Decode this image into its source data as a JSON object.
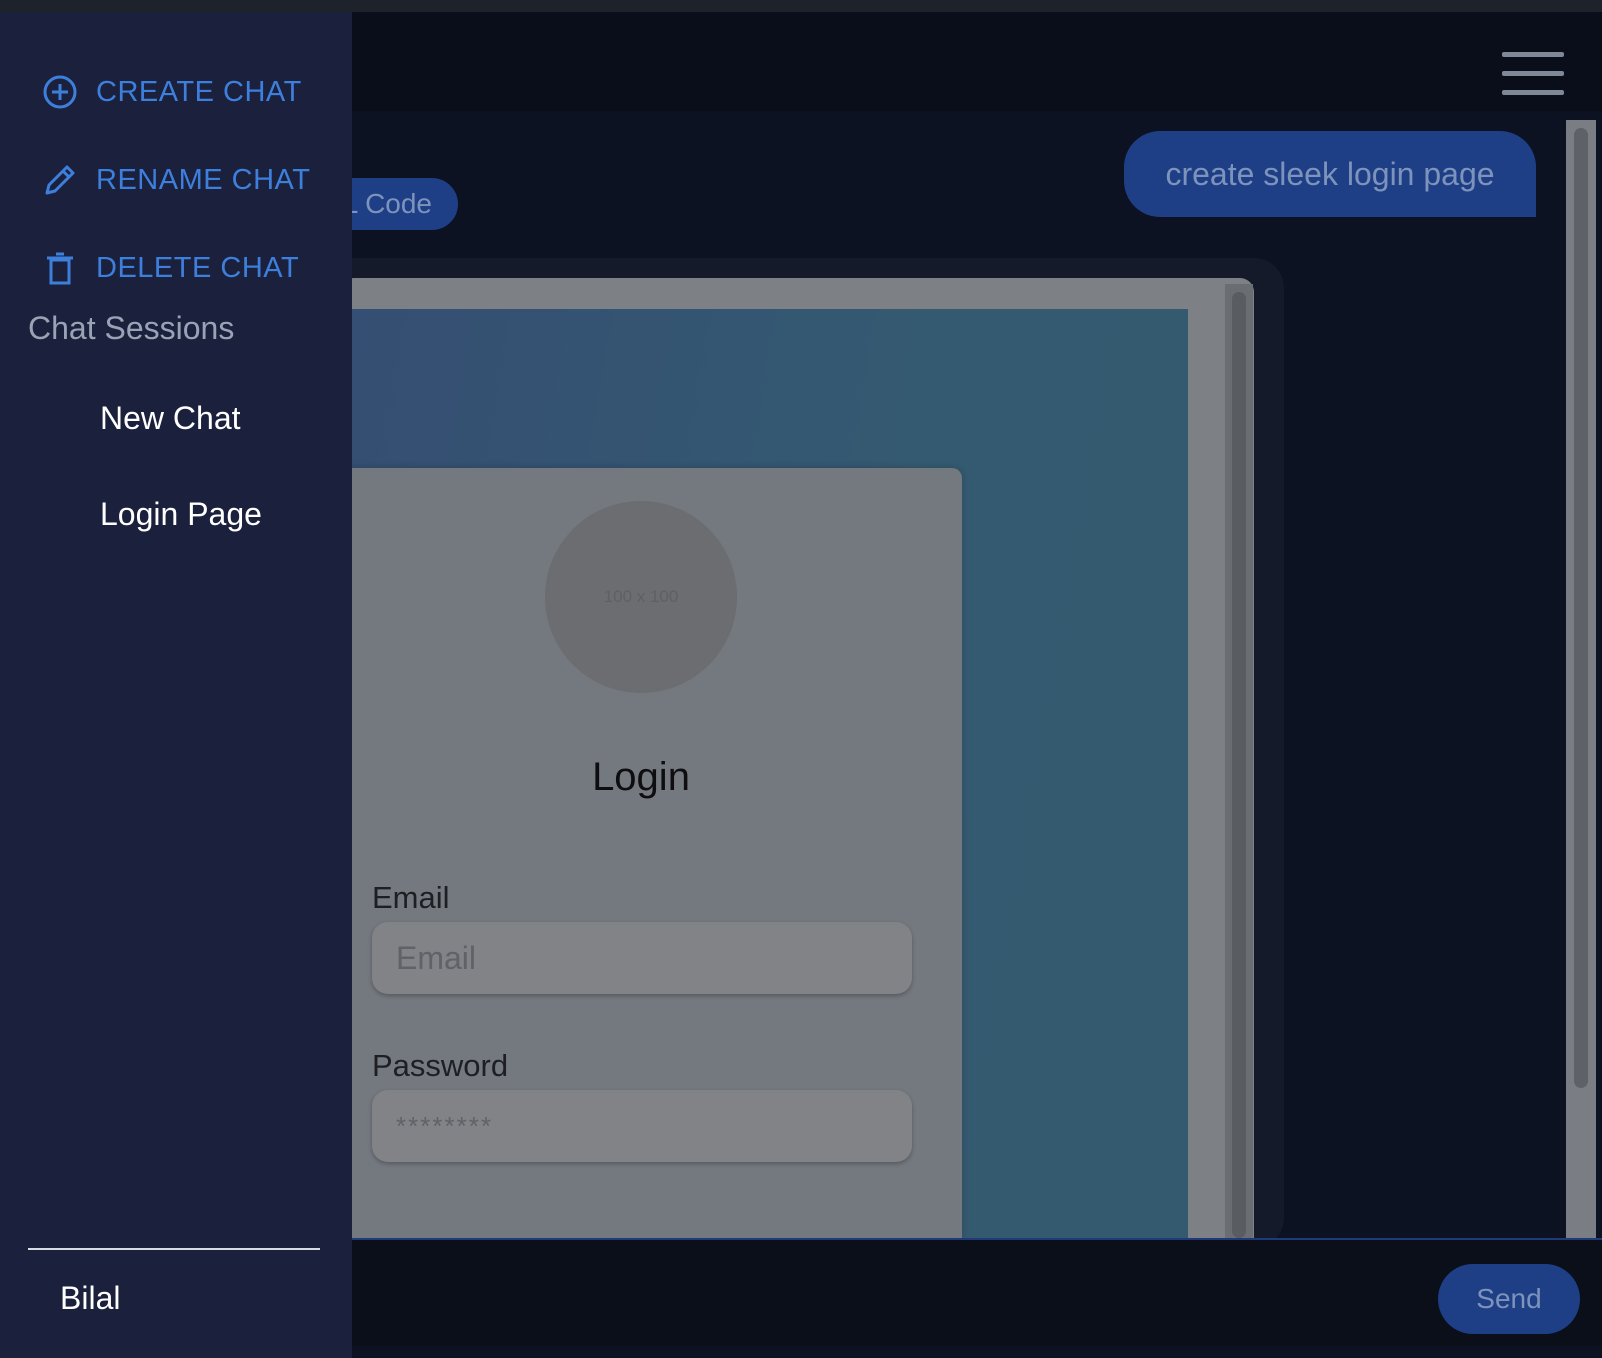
{
  "sidebar": {
    "actions": [
      {
        "label": "CREATE CHAT",
        "icon": "plus-circle-icon"
      },
      {
        "label": "RENAME CHAT",
        "icon": "pencil-icon"
      },
      {
        "label": "DELETE CHAT",
        "icon": "trash-icon"
      }
    ],
    "sessions_heading": "Chat Sessions",
    "sessions": [
      {
        "label": "New Chat"
      },
      {
        "label": "Login Page"
      }
    ],
    "user_name": "Bilal"
  },
  "header": {
    "menu_icon": "hamburger-icon"
  },
  "chat": {
    "user_message": "create sleek login page",
    "code_chip_label": "L Code"
  },
  "preview": {
    "avatar_placeholder": "100 x 100",
    "login_title": "Login",
    "email_label": "Email",
    "email_placeholder": "Email",
    "password_label": "Password",
    "password_placeholder": "********"
  },
  "composer": {
    "send_label": "Send"
  },
  "colors": {
    "accent": "#3d7fdc",
    "bubble": "#1e3f86",
    "sidebar_bg": "#1b213d",
    "app_bg": "#0c1221"
  }
}
